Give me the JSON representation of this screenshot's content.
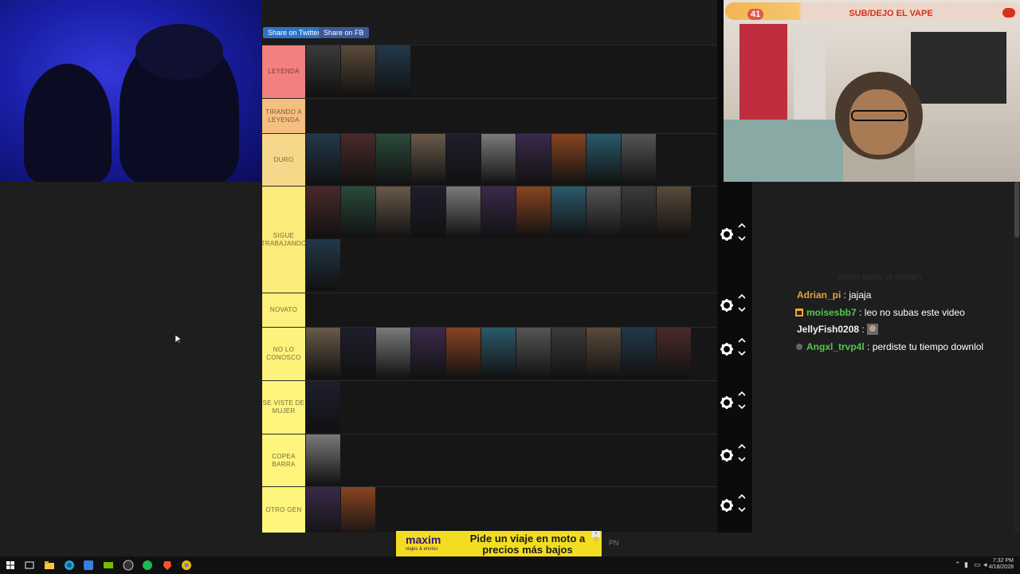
{
  "share_buttons": {
    "twitter": "Share on Twitter",
    "facebook": "Share on FB"
  },
  "tiers": [
    {
      "label": "LEYENDA",
      "color": "#f28080",
      "thumbs": 3
    },
    {
      "label": "TIRANDO A LEYENDA",
      "color": "#f5bf80",
      "thumbs": 0
    },
    {
      "label": "DURO",
      "color": "#f6d88a",
      "thumbs": 10
    },
    {
      "label": "SIGUE TRABAJANDO",
      "color": "#fbec7a",
      "thumbs": 12
    },
    {
      "label": "NOVATO",
      "color": "#fdf07c",
      "thumbs": 0
    },
    {
      "label": "NO LO CONOSCO",
      "color": "#fdf37c",
      "thumbs": 11
    },
    {
      "label": "SE VISTE DE MUJER",
      "color": "#fdf57c",
      "thumbs": 1
    },
    {
      "label": "COPEA BARRA",
      "color": "#fdf57c",
      "thumbs": 1
    },
    {
      "label": "OTRO GEN",
      "color": "#fdf57c",
      "thumbs": 2
    }
  ],
  "icons": {
    "gear": "gear-icon",
    "up": "chevron-up-icon",
    "down": "chevron-down-icon"
  },
  "goal": {
    "count": "41",
    "text": "SUB/DEJO EL VAPE"
  },
  "chat": {
    "faded": "mejor borra el stream",
    "messages": [
      {
        "user": "Adrian_pi",
        "text": " : jajaja",
        "color": "#e5a33b",
        "badge": ""
      },
      {
        "user": "moisesbb7",
        "text": " : leo no subas este video",
        "color": "#52c84f",
        "badge": "gift-badge-icon"
      },
      {
        "user": "JellyFish0208",
        "text": " : ",
        "color": "#f2f2f2",
        "badge": ""
      },
      {
        "user": "Angxl_trvp4l",
        "text": " : perdiste tu tiempo downlol",
        "color": "#52c84f",
        "badge": "circle-badge-icon"
      }
    ]
  },
  "ad": {
    "logo": "maxim",
    "sub": "viajes & envíos",
    "text": "Pide un viaje en moto a precios más bajos",
    "close": "× ⓘ"
  },
  "pn": "PN",
  "tray": {
    "time": "7:32 PM",
    "date": "4/18/2028"
  }
}
